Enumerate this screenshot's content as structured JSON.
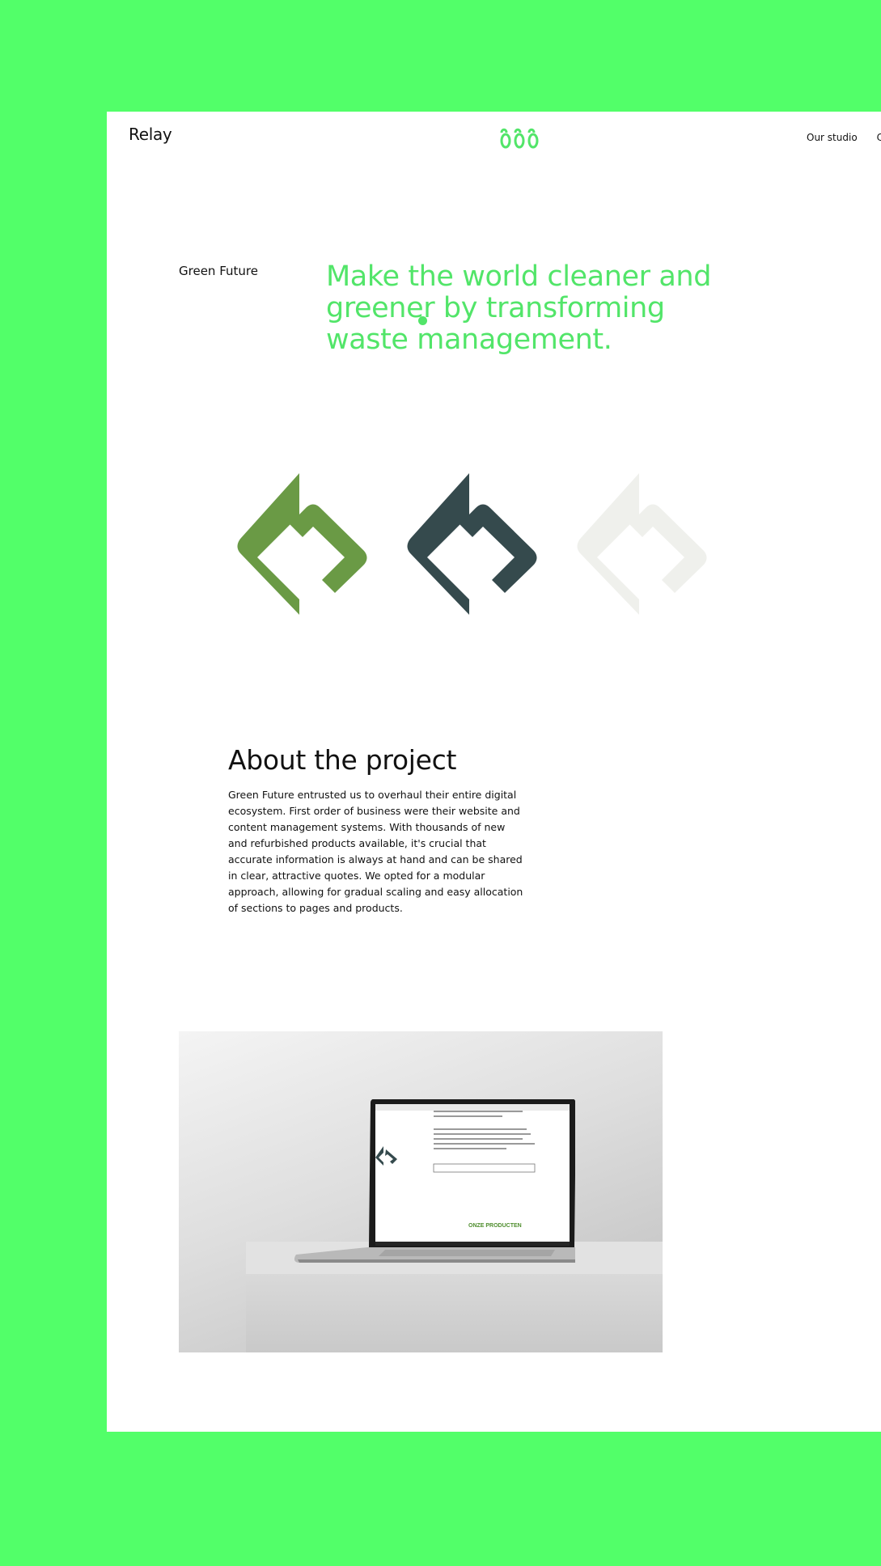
{
  "header": {
    "logo": "Relay",
    "brand_mark_icon": "triple-loop-logo-icon",
    "nav": [
      "Our studio",
      "Co"
    ]
  },
  "hero": {
    "client": "Green Future",
    "headline": "Make the world cleaner and greener by transforming waste management."
  },
  "logo_variants": [
    {
      "name": "green",
      "color": "#6a9a45"
    },
    {
      "name": "dark",
      "color": "#354a4d"
    },
    {
      "name": "light",
      "color": "#eff0ec"
    }
  ],
  "about": {
    "title": "About the project",
    "body": "Green Future entrusted us to overhaul their entire digital ecosystem. First order of business were their website and content management systems. With thousands of new and refurbished products available, it's crucial that accurate information is always at hand and can be shared in clear, attractive quotes. We opted for a modular approach, allowing for gradual scaling and easy allocation of sections to pages and products."
  },
  "mockup": {
    "screen_heading": "ONZE PRODUCTEN"
  },
  "colors": {
    "background": "#52ff69",
    "accent": "#52e569",
    "page": "#ffffff"
  }
}
